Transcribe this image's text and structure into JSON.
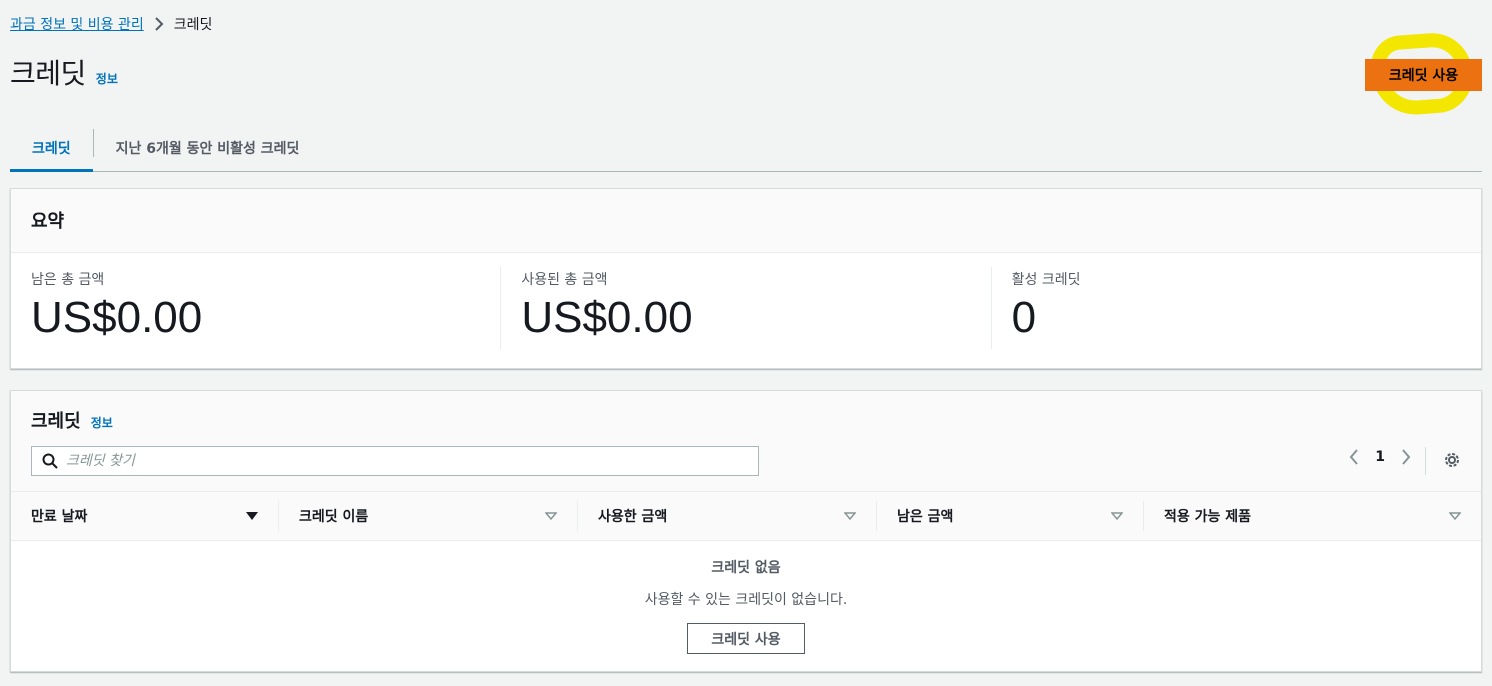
{
  "breadcrumb": {
    "parent": "과금 정보 및 비용 관리",
    "current": "크레딧"
  },
  "header": {
    "title": "크레딧",
    "info": "정보",
    "primary_action": "크레딧 사용"
  },
  "tabs": [
    {
      "label": "크레딧",
      "active": true
    },
    {
      "label": "지난 6개월 동안 비활성 크레딧",
      "active": false
    }
  ],
  "summary": {
    "title": "요약",
    "metrics": [
      {
        "label": "남은 총 금액",
        "value": "US$0.00"
      },
      {
        "label": "사용된 총 금액",
        "value": "US$0.00"
      },
      {
        "label": "활성 크레딧",
        "value": "0"
      }
    ]
  },
  "credits": {
    "title": "크레딧",
    "info": "정보",
    "search_placeholder": "크레딧 찾기",
    "page": "1",
    "columns": [
      "만료 날짜",
      "크레딧 이름",
      "사용한 금액",
      "남은 금액",
      "적용 가능 제품"
    ],
    "empty_title": "크레딧 없음",
    "empty_desc": "사용할 수 있는 크레딧이 없습니다.",
    "empty_action": "크레딧 사용"
  },
  "colors": {
    "accent": "#0073bb",
    "primary": "#ec7211",
    "highlight": "#f3e600"
  },
  "icons": [
    "chevron-right-icon",
    "search-icon",
    "chevron-left-icon",
    "gear-icon",
    "sort-desc-icon",
    "sort-icon"
  ]
}
